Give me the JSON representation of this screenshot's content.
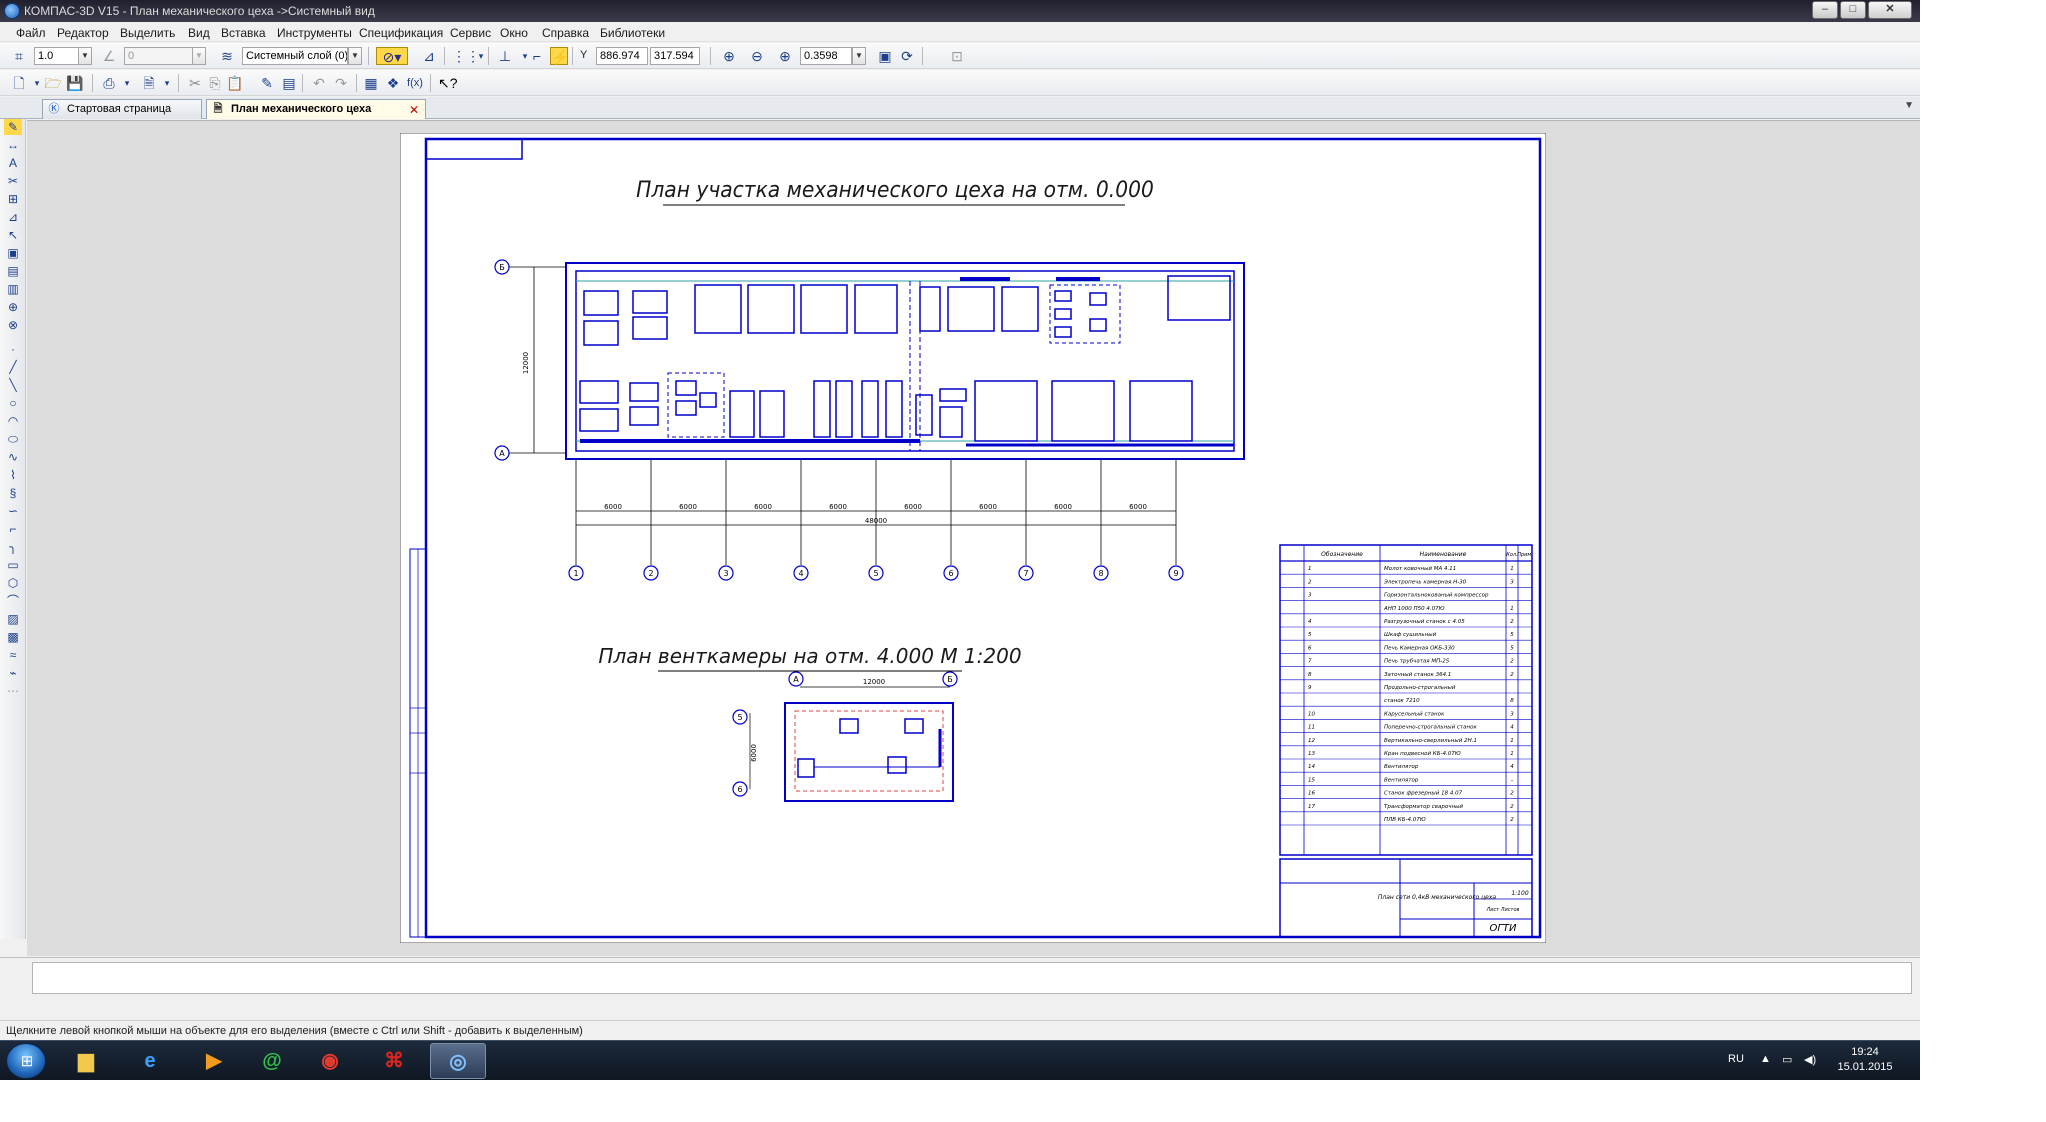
{
  "window": {
    "title": "КОМПАС-3D V15 - План механического цеха ->Системный вид",
    "controls": {
      "minimize": "–",
      "maximize": "□",
      "close": "✕"
    }
  },
  "menu": [
    "Файл",
    "Редактор",
    "Выделить",
    "Вид",
    "Вставка",
    "Инструменты",
    "Спецификация",
    "Сервис",
    "Окно",
    "Справка",
    "Библиотеки"
  ],
  "toolbar1": {
    "step_value": "1.0",
    "angle_value": "0",
    "layer_value": "Системный слой (0)",
    "coord_label": "Y",
    "coord_x": "886.974",
    "coord_y": "317.594",
    "zoom_value": "0.3598"
  },
  "tabs": [
    {
      "label": "Стартовая страница",
      "icon": "kompas-logo-icon",
      "active": false
    },
    {
      "label": "План механического цеха",
      "icon": "drawing-doc-icon",
      "active": true,
      "close": "✕"
    }
  ],
  "drawing": {
    "title_main": "План участка механического цеха на отм. 0.000",
    "title_vent": "План венткамеры на отм. 4.000   М 1:200",
    "dim_total": "48000",
    "dim_height": "12000",
    "dim_span": "6000",
    "axes_x": [
      "1",
      "2",
      "3",
      "4",
      "5",
      "6",
      "7",
      "8",
      "9"
    ],
    "axes_y": [
      "Б",
      "А"
    ],
    "vent_axes_x": [
      "А",
      "Б"
    ],
    "vent_axes_y": [
      "5",
      "6"
    ],
    "vent_dim_w": "12000",
    "vent_dim_h": "6000",
    "spec_headers": [
      "Обозначение",
      "Наименование",
      "Кол.",
      "Прим."
    ],
    "spec_rows": [
      [
        "1",
        "Молот ковочный МА 4.11",
        "1"
      ],
      [
        "2",
        "Электропечь камерная Н-30",
        "3"
      ],
      [
        "3",
        "Горизонтальнокованый компрессор",
        ""
      ],
      [
        "",
        "АНП 1000 П50 4.07Ю",
        "1"
      ],
      [
        "4",
        "Разгрузочный станок с 4.05",
        "2"
      ],
      [
        "5",
        "Шкаф сушильный",
        "5"
      ],
      [
        "6",
        "Печь Камерная ОКБ-330",
        "5"
      ],
      [
        "7",
        "Печь трубчатая МП-25",
        "2"
      ],
      [
        "8",
        "Заточный станок 364.1",
        "2"
      ],
      [
        "9",
        "Продольно-строгальный",
        ""
      ],
      [
        "",
        "станок 7210",
        "8"
      ],
      [
        "10",
        "Карусельный станок",
        "3"
      ],
      [
        "11",
        "Поперечно-строгальный станок",
        "4"
      ],
      [
        "12",
        "Вертикально-сверлильный 2Н.1",
        "1"
      ],
      [
        "13",
        "Кран подвесной КБ-4.07Ю",
        "1"
      ],
      [
        "14",
        "Вентилятор",
        "4"
      ],
      [
        "15",
        "Вентилятор",
        "–"
      ],
      [
        "16",
        "Станок фрезерный 18 4.07",
        "2"
      ],
      [
        "17",
        "Трансформатор сварочный",
        "2"
      ],
      [
        "",
        "ПЛВ КБ-4.07Ю",
        "2"
      ]
    ],
    "stamp_title": "План сети 0,4кВ механического цеха",
    "stamp_scale": "1:100",
    "stamp_org": "ОГТИ",
    "stamp_sheets": "Лист  Листов"
  },
  "status": {
    "hint": "Щелкните левой кнопкой мыши на объекте для его выделения (вместе с Ctrl или Shift - добавить к выделенным)"
  },
  "taskbar": {
    "apps": [
      "explorer",
      "internet-explorer",
      "media-player",
      "mail-agent",
      "chrome",
      "acrobat",
      "kompas"
    ],
    "lang": "RU",
    "time": "19:24",
    "date": "15.01.2015"
  }
}
